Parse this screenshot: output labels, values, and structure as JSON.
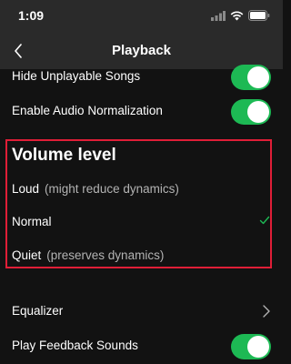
{
  "status": {
    "time": "1:09"
  },
  "nav": {
    "title": "Playback"
  },
  "settings": {
    "hide_unplayable": {
      "label": "Hide Unplayable Songs",
      "on": true
    },
    "audio_normalization": {
      "label": "Enable Audio Normalization",
      "on": true
    }
  },
  "volume": {
    "heading": "Volume level",
    "options": [
      {
        "label": "Loud",
        "sub": "(might reduce dynamics)",
        "selected": false
      },
      {
        "label": "Normal",
        "sub": "",
        "selected": true
      },
      {
        "label": "Quiet",
        "sub": "(preserves dynamics)",
        "selected": false
      }
    ]
  },
  "equalizer": {
    "label": "Equalizer"
  },
  "feedback": {
    "label": "Play Feedback Sounds",
    "on": true
  },
  "colors": {
    "accent": "#1db954",
    "highlight": "#e01e37",
    "background": "#121212"
  },
  "icons": [
    "signal-icon",
    "wifi-icon",
    "battery-icon",
    "back-chevron-icon",
    "checkmark-icon",
    "chevron-right-icon"
  ]
}
